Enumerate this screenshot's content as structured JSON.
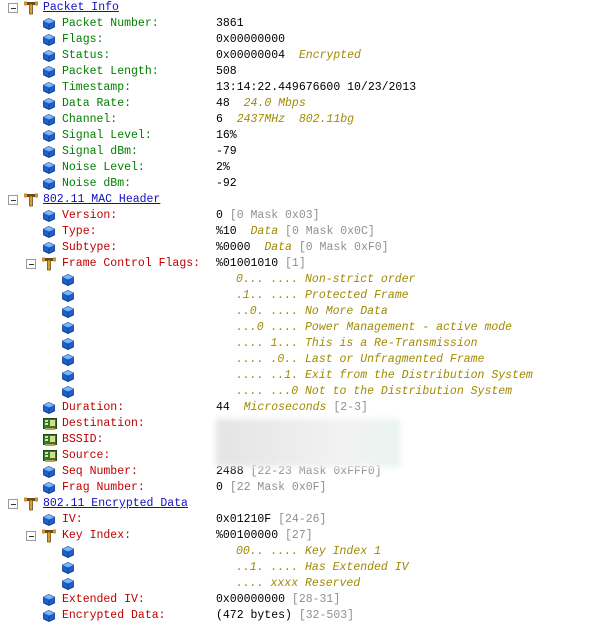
{
  "colors": {
    "section": "#1010c0",
    "packet_info_label": "#008000",
    "field_label": "#c00000",
    "note": "#a08a00",
    "range": "#909090"
  },
  "rows": [
    {
      "type": "section",
      "label": "Packet Info"
    },
    {
      "type": "field",
      "icon": "cube",
      "color": "green",
      "label": "Packet Number:",
      "value": "3861"
    },
    {
      "type": "field",
      "icon": "cube",
      "color": "green",
      "label": "Flags:",
      "value": "0x00000000"
    },
    {
      "type": "field",
      "icon": "cube",
      "color": "green",
      "label": "Status:",
      "value": "0x00000004",
      "note": "Encrypted"
    },
    {
      "type": "field",
      "icon": "cube",
      "color": "green",
      "label": "Packet Length:",
      "value": "508"
    },
    {
      "type": "field",
      "icon": "cube",
      "color": "green",
      "label": "Timestamp:",
      "value": "13:14:22.449676600 10/23/2013"
    },
    {
      "type": "field",
      "icon": "cube",
      "color": "green",
      "label": "Data Rate:",
      "value": "48",
      "note": "24.0 Mbps"
    },
    {
      "type": "field",
      "icon": "cube",
      "color": "green",
      "label": "Channel:",
      "value": "6",
      "note": "2437MHz  802.11bg"
    },
    {
      "type": "field",
      "icon": "cube",
      "color": "green",
      "label": "Signal Level:",
      "value": "16%"
    },
    {
      "type": "field",
      "icon": "cube",
      "color": "green",
      "label": "Signal dBm:",
      "value": "-79"
    },
    {
      "type": "field",
      "icon": "cube",
      "color": "green",
      "label": "Noise Level:",
      "value": "2%"
    },
    {
      "type": "field",
      "icon": "cube",
      "color": "green",
      "label": "Noise dBm:",
      "value": "-92"
    },
    {
      "type": "section",
      "label": "802.11 MAC Header"
    },
    {
      "type": "field",
      "icon": "cube",
      "color": "red",
      "label": "Version:",
      "value": "0",
      "range": "[0 Mask 0x03]"
    },
    {
      "type": "field",
      "icon": "cube",
      "color": "red",
      "label": "Type:",
      "value": "%10",
      "note": "Data",
      "range": "[0 Mask 0x0C]"
    },
    {
      "type": "field",
      "icon": "cube",
      "color": "red",
      "label": "Subtype:",
      "value": "%0000",
      "note": "Data",
      "range": "[0 Mask 0xF0]"
    },
    {
      "type": "subsection",
      "color": "red",
      "label": "Frame Control Flags:",
      "value": "%01001010",
      "range": "[1]"
    },
    {
      "type": "bit",
      "text": "0... .... Non-strict order"
    },
    {
      "type": "bit",
      "text": ".1.. .... Protected Frame"
    },
    {
      "type": "bit",
      "text": "..0. .... No More Data"
    },
    {
      "type": "bit",
      "text": "...0 .... Power Management - active mode"
    },
    {
      "type": "bit",
      "text": ".... 1... This is a Re-Transmission"
    },
    {
      "type": "bit",
      "text": ".... .0.. Last or Unfragmented Frame"
    },
    {
      "type": "bit",
      "text": ".... ..1. Exit from the Distribution System"
    },
    {
      "type": "bit",
      "text": ".... ...0 Not to the Distribution System"
    },
    {
      "type": "field",
      "icon": "cube",
      "color": "red",
      "label": "Duration:",
      "value": "44",
      "note": "Microseconds",
      "range": "[2-3]"
    },
    {
      "type": "field",
      "icon": "nic",
      "color": "red",
      "label": "Destination:"
    },
    {
      "type": "field",
      "icon": "nic",
      "color": "red",
      "label": "BSSID:"
    },
    {
      "type": "field",
      "icon": "nic",
      "color": "red",
      "label": "Source:"
    },
    {
      "type": "field",
      "icon": "cube",
      "color": "red",
      "label": "Seq Number:",
      "value": "2488",
      "range": "[22-23 Mask 0xFFF0]"
    },
    {
      "type": "field",
      "icon": "cube",
      "color": "red",
      "label": "Frag Number:",
      "value": "0",
      "range": "[22 Mask 0x0F]"
    },
    {
      "type": "section",
      "label": "802.11 Encrypted Data"
    },
    {
      "type": "field",
      "icon": "cube",
      "color": "red",
      "label": "IV:",
      "value": "0x01210F",
      "range": "[24-26]"
    },
    {
      "type": "subsection",
      "color": "red",
      "label": "Key Index:",
      "value": "%00100000",
      "range": "[27]"
    },
    {
      "type": "bit",
      "text": "00.. .... Key Index 1"
    },
    {
      "type": "bit",
      "text": "..1. .... Has Extended IV"
    },
    {
      "type": "bit",
      "text": ".... xxxx Reserved"
    },
    {
      "type": "field",
      "icon": "cube",
      "color": "red",
      "label": "Extended IV:",
      "value": "0x00000000",
      "range": "[28-31]"
    },
    {
      "type": "field",
      "icon": "cube",
      "color": "red",
      "label": "Encrypted Data:",
      "value": "(472 bytes)",
      "range": "[32-503]"
    }
  ]
}
